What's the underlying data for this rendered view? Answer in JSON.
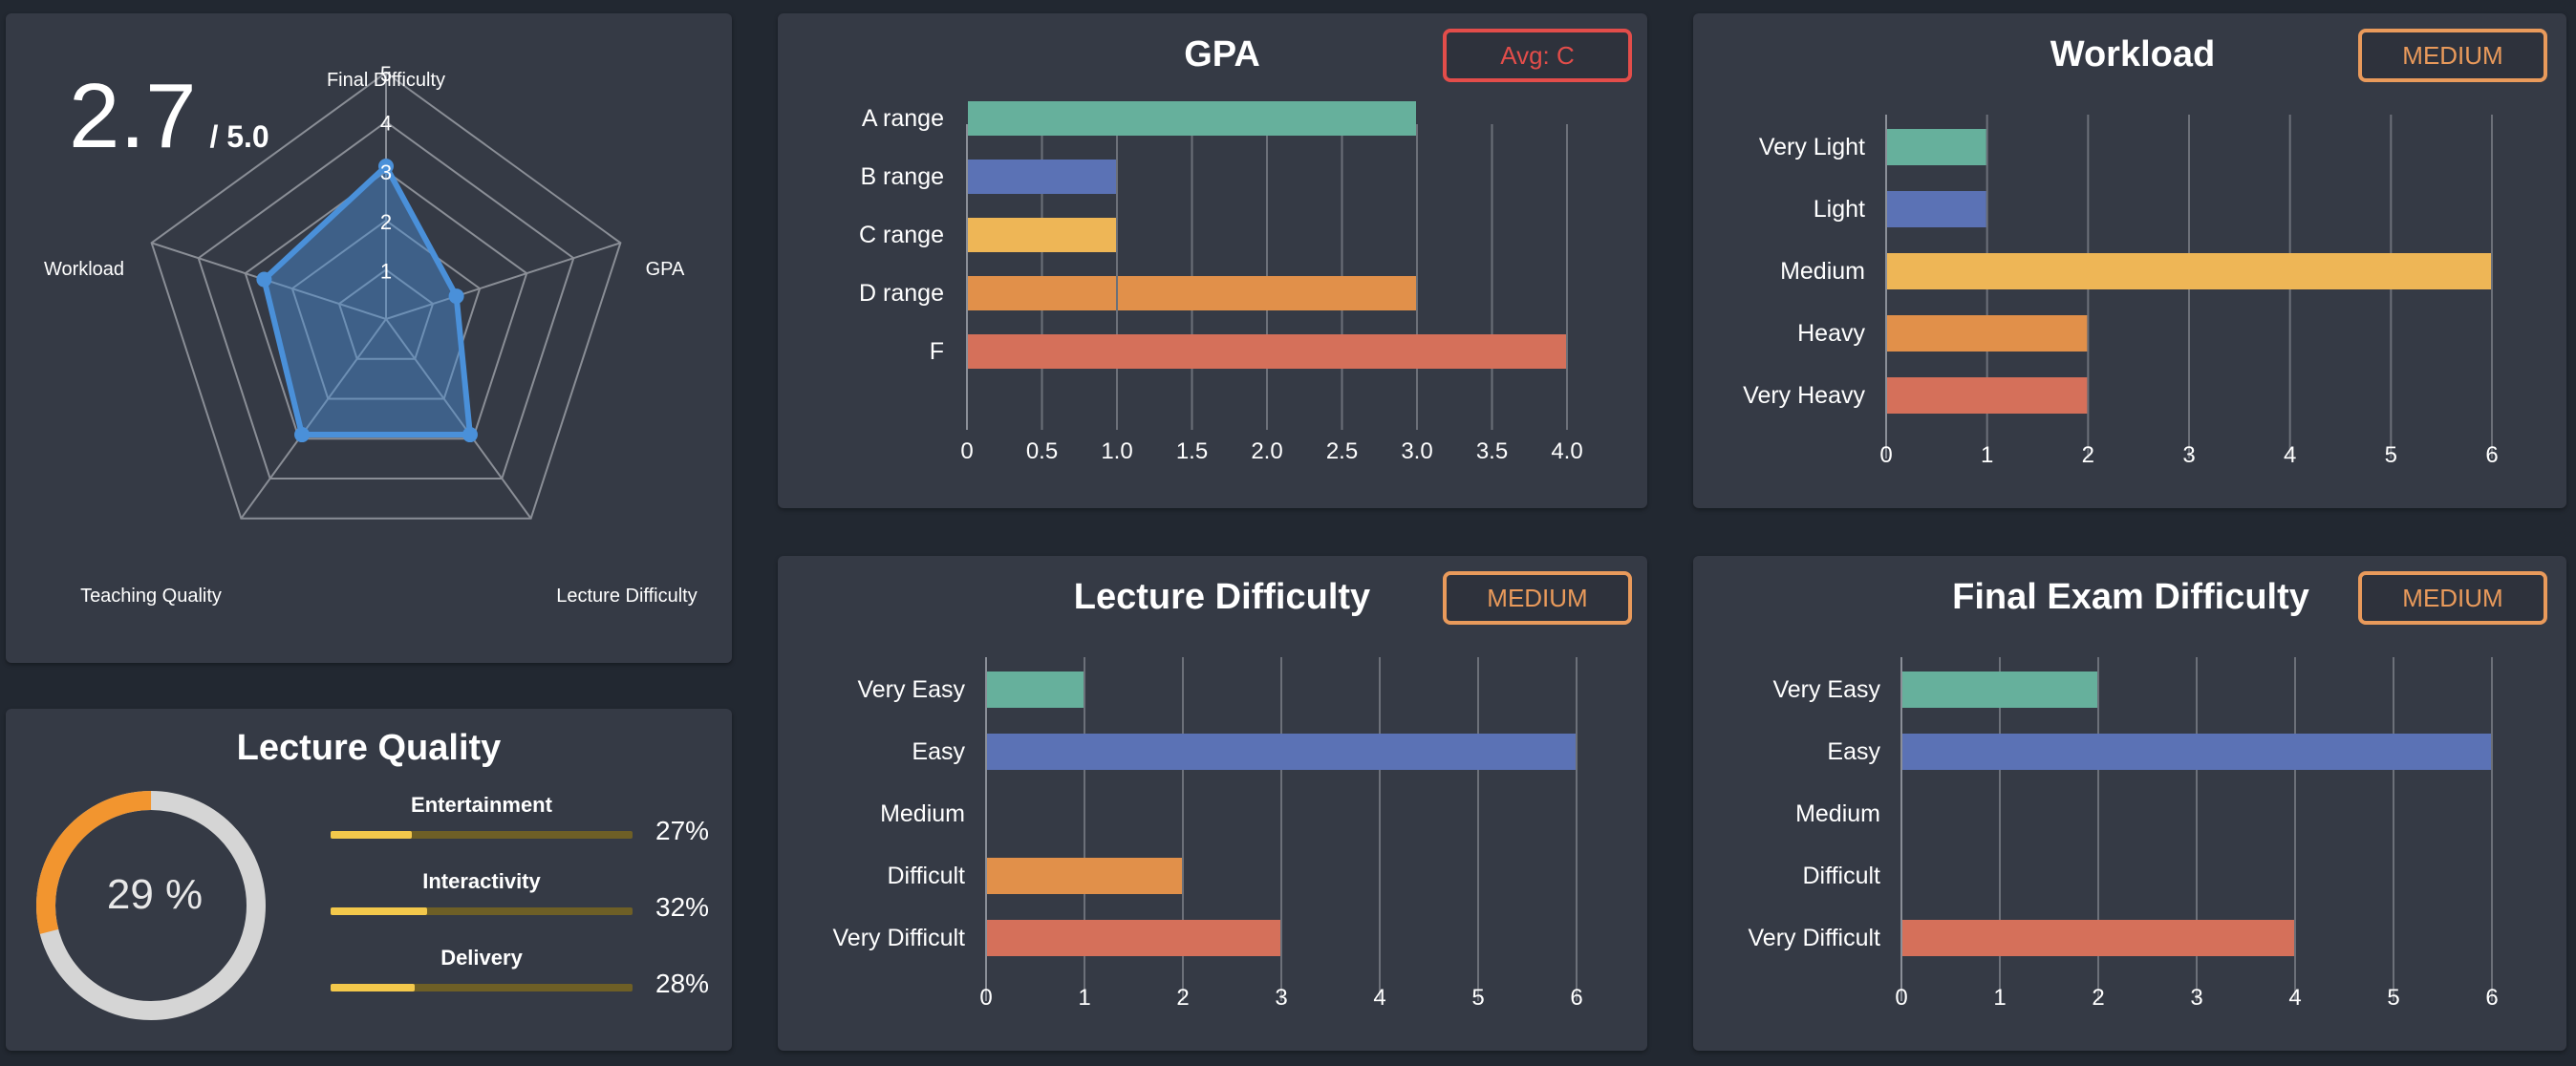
{
  "summary": {
    "score": "2.7",
    "max": "/ 5.0"
  },
  "radar": {
    "axes": [
      "Final Difficulty",
      "GPA",
      "Lecture Difficulty",
      "Teaching Quality",
      "Workload"
    ],
    "values": [
      3.1,
      1.5,
      2.9,
      2.9,
      2.6
    ],
    "ticks": [
      "1",
      "2",
      "3",
      "4",
      "5"
    ],
    "max": 5,
    "color": "#4a90d9"
  },
  "lecture_quality": {
    "title": "Lecture Quality",
    "overall_percent": 29,
    "overall_label": "29 %",
    "items": [
      {
        "label": "Entertainment",
        "percent": 27,
        "percent_label": "27%"
      },
      {
        "label": "Interactivity",
        "percent": 32,
        "percent_label": "32%"
      },
      {
        "label": "Delivery",
        "percent": 28,
        "percent_label": "28%"
      }
    ]
  },
  "colors": {
    "teal": "#66b09c",
    "blue": "#5b72b5",
    "yellow": "#eeb656",
    "orange": "#e1904a",
    "red": "#d5705a",
    "badge_red": "#e34d4a",
    "badge_orange": "#e99a5b",
    "donut_orange": "#f2952f",
    "donut_gray": "#d5d5d5"
  },
  "chart_data": [
    {
      "id": "gpa",
      "type": "bar",
      "title": "GPA",
      "badge": "Avg: C",
      "categories": [
        "A range",
        "B range",
        "C range",
        "D range",
        "F"
      ],
      "segments": [
        [
          3.0
        ],
        [
          1.0
        ],
        [
          1.0
        ],
        [
          1.0,
          2.0
        ],
        [
          4.0
        ]
      ],
      "xticks": [
        "0",
        "0.5",
        "1.0",
        "1.5",
        "2.0",
        "2.5",
        "3.0",
        "3.5",
        "4.0"
      ],
      "xlim": [
        0,
        4
      ],
      "grid": true
    },
    {
      "id": "workload",
      "type": "bar",
      "title": "Workload",
      "badge": "MEDIUM",
      "categories": [
        "Very Light",
        "Light",
        "Medium",
        "Heavy",
        "Very Heavy"
      ],
      "values": [
        1,
        1,
        6,
        2,
        2
      ],
      "xticks": [
        "0",
        "1",
        "2",
        "3",
        "4",
        "5",
        "6"
      ],
      "xlim": [
        0,
        6
      ],
      "grid": true
    },
    {
      "id": "lecture",
      "type": "bar",
      "title": "Lecture Difficulty",
      "badge": "MEDIUM",
      "categories": [
        "Very Easy",
        "Easy",
        "Medium",
        "Difficult",
        "Very Difficult"
      ],
      "values": [
        1,
        6,
        0,
        2,
        3
      ],
      "xticks": [
        "0",
        "1",
        "2",
        "3",
        "4",
        "5",
        "6"
      ],
      "xlim": [
        0,
        6
      ],
      "grid": true
    },
    {
      "id": "final",
      "type": "bar",
      "title": "Final Exam Difficulty",
      "badge": "MEDIUM",
      "categories": [
        "Very Easy",
        "Easy",
        "Medium",
        "Difficult",
        "Very Difficult"
      ],
      "values": [
        2,
        6,
        0,
        0,
        4
      ],
      "xticks": [
        "0",
        "1",
        "2",
        "3",
        "4",
        "5",
        "6"
      ],
      "xlim": [
        0,
        6
      ],
      "grid": true
    }
  ]
}
